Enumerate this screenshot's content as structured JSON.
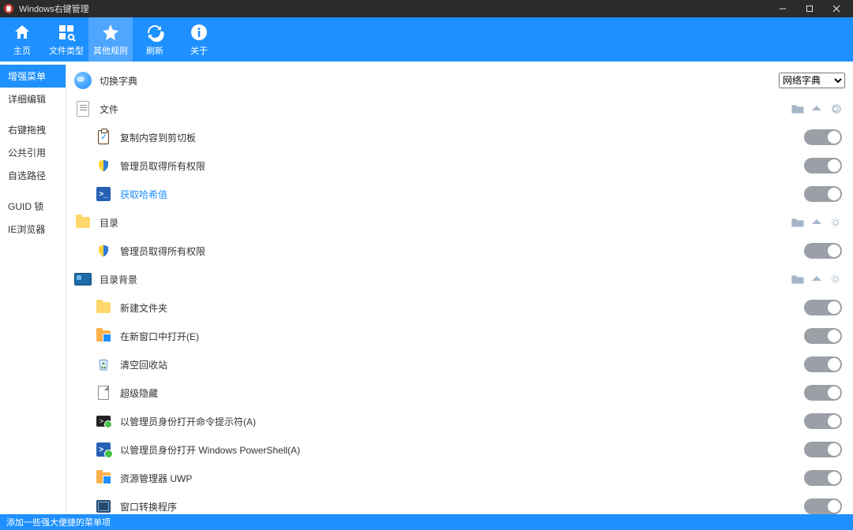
{
  "titlebar": {
    "title": "Windows右键管理"
  },
  "topbar": {
    "home": "主页",
    "filetype": "文件类型",
    "otherrules": "其他规则",
    "refresh": "刷新",
    "about": "关于"
  },
  "sidebar": {
    "items": [
      {
        "label": "增强菜单",
        "active": true
      },
      {
        "label": "详细编辑"
      },
      {
        "label": "右键拖拽"
      },
      {
        "label": "公共引用"
      },
      {
        "label": "自选路径"
      },
      {
        "label": "GUID 锁"
      },
      {
        "label": "IE浏览器"
      }
    ]
  },
  "content": {
    "switch_dict": "切换字典",
    "dict_select_value": "网络字典",
    "sec_file": "文件",
    "sec_dir": "目录",
    "sec_dirbg": "目录背景",
    "items_file": [
      {
        "label": "复制内容到剪切板"
      },
      {
        "label": "管理员取得所有权限"
      },
      {
        "label": "获取哈希值",
        "hl": true
      }
    ],
    "items_dir": [
      {
        "label": "管理员取得所有权限"
      }
    ],
    "items_dirbg": [
      {
        "label": "新建文件夹"
      },
      {
        "label": "在新窗口中打开(E)"
      },
      {
        "label": "清空回收站"
      },
      {
        "label": "超级隐藏"
      },
      {
        "label": "以管理员身份打开命令提示符(A)"
      },
      {
        "label": "以管理员身份打开 Windows PowerShell(A)"
      },
      {
        "label": "资源管理器 UWP"
      },
      {
        "label": "窗口转换程序"
      }
    ]
  },
  "statusbar": {
    "text": "添加一些强大便捷的菜单项"
  }
}
